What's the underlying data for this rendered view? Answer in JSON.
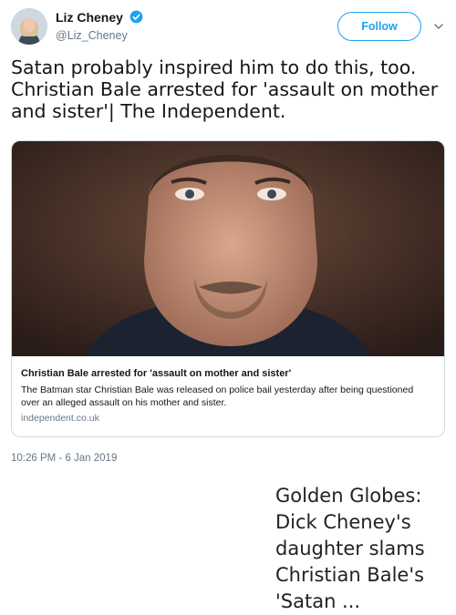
{
  "tweet": {
    "author": {
      "display_name": "Liz Cheney",
      "handle": "@Liz_Cheney",
      "verified": true
    },
    "follow_label": "Follow",
    "text": "Satan probably inspired him to do this, too.\nChristian Bale arrested for 'assault on mother and sister'| The Independent.",
    "card": {
      "title": "Christian Bale arrested for 'assault on mother and sister'",
      "description": "The Batman star Christian Bale was released on police bail yesterday after being questioned over an alleged assault on his mother and sister.",
      "domain": "independent.co.uk"
    },
    "timestamp": "10:26 PM - 6 Jan 2019"
  },
  "caption": "Golden Globes: Dick Cheney's daughter slams Christian Bale's 'Satan ...",
  "colors": {
    "accent": "#1da1f2",
    "muted": "#657786",
    "border": "#cfd9de"
  },
  "icons": {
    "verified": "verified-badge-icon",
    "chevron": "chevron-down-icon"
  }
}
